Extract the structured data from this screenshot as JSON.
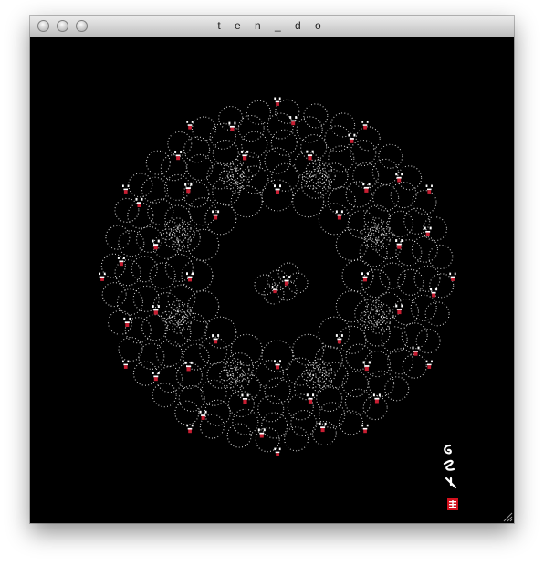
{
  "window": {
    "title": "t e n _ d o"
  },
  "colors": {
    "background": "#000000",
    "dots": "#ffffff",
    "mouth": "#c81e32",
    "seal": "#d4111e"
  },
  "icons": {
    "close": "traffic-light-close",
    "minimize": "traffic-light-minimize",
    "zoom": "traffic-light-zoom",
    "resize": "resize-grip"
  }
}
